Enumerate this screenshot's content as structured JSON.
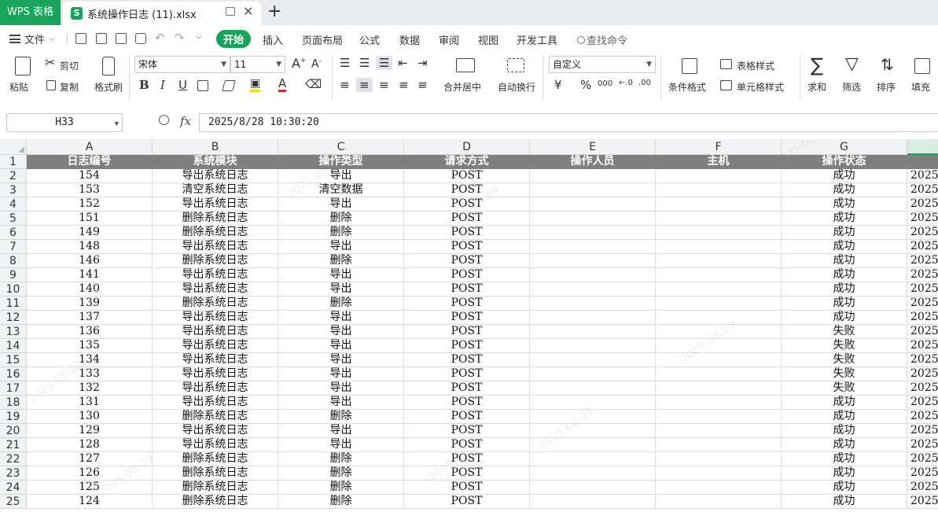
{
  "titlebar": {
    "app_name": "WPS 表格",
    "doc_icon_letter": "S",
    "doc_name": "系统操作日志 (11).xlsx",
    "close_glyph": "✕",
    "new_tab_glyph": "+"
  },
  "menubar": {
    "file_label": "文件",
    "tabs": [
      "开始",
      "插入",
      "页面布局",
      "公式",
      "数据",
      "审阅",
      "视图",
      "开发工具"
    ],
    "search_label": "查找命令"
  },
  "ribbon": {
    "paste": "粘贴",
    "cut": "剪切",
    "copy": "复制",
    "format_painter": "格式刷",
    "font_name": "宋体",
    "font_size": "11",
    "bold": "B",
    "italic": "I",
    "underline": "U",
    "font_color_glyph": "A",
    "merge_center": "合并居中",
    "wrap_text": "自动换行",
    "number_format": "自定义",
    "currency_glyph": "¥",
    "percent_glyph": "%",
    "thousands_glyph": "000",
    "conditional_format": "条件格式",
    "table_style": "表格样式",
    "cell_style": "单元格样式",
    "sum": "求和",
    "filter": "筛选",
    "sort": "排序",
    "fill": "填充"
  },
  "formula": {
    "cell_ref": "H33",
    "fx_label": "fx",
    "value": "2025/8/28 10:30:20"
  },
  "grid": {
    "columns": [
      "A",
      "B",
      "C",
      "D",
      "E",
      "F",
      "G",
      ""
    ],
    "rows": [
      {
        "n": "1",
        "cells": [
          "日志编号",
          "系统模块",
          "操作类型",
          "请求方式",
          "操作人员",
          "主机",
          "操作状态",
          ""
        ]
      },
      {
        "n": "2",
        "cells": [
          "154",
          "导出系统日志",
          "导出",
          "POST",
          "",
          "",
          "成功",
          "2025-"
        ]
      },
      {
        "n": "3",
        "cells": [
          "153",
          "清空系统日志",
          "清空数据",
          "POST",
          "",
          "",
          "成功",
          "2025-"
        ]
      },
      {
        "n": "4",
        "cells": [
          "152",
          "导出系统日志",
          "导出",
          "POST",
          "",
          "",
          "成功",
          "2025-"
        ]
      },
      {
        "n": "5",
        "cells": [
          "151",
          "删除系统日志",
          "删除",
          "POST",
          "",
          "",
          "成功",
          "2025-"
        ]
      },
      {
        "n": "6",
        "cells": [
          "149",
          "删除系统日志",
          "删除",
          "POST",
          "",
          "",
          "成功",
          "2025-"
        ]
      },
      {
        "n": "7",
        "cells": [
          "148",
          "导出系统日志",
          "导出",
          "POST",
          "",
          "",
          "成功",
          "2025-"
        ]
      },
      {
        "n": "8",
        "cells": [
          "146",
          "删除系统日志",
          "删除",
          "POST",
          "",
          "",
          "成功",
          "2025-"
        ]
      },
      {
        "n": "9",
        "cells": [
          "141",
          "导出系统日志",
          "导出",
          "POST",
          "",
          "",
          "成功",
          "2025-"
        ]
      },
      {
        "n": "10",
        "cells": [
          "140",
          "导出系统日志",
          "导出",
          "POST",
          "",
          "",
          "成功",
          "2025-"
        ]
      },
      {
        "n": "11",
        "cells": [
          "139",
          "删除系统日志",
          "删除",
          "POST",
          "",
          "",
          "成功",
          "2025-"
        ]
      },
      {
        "n": "12",
        "cells": [
          "137",
          "导出系统日志",
          "导出",
          "POST",
          "",
          "",
          "成功",
          "2025-"
        ]
      },
      {
        "n": "13",
        "cells": [
          "136",
          "导出系统日志",
          "导出",
          "POST",
          "",
          "",
          "失败",
          "2025-"
        ]
      },
      {
        "n": "14",
        "cells": [
          "135",
          "导出系统日志",
          "导出",
          "POST",
          "",
          "",
          "失败",
          "2025-"
        ]
      },
      {
        "n": "15",
        "cells": [
          "134",
          "导出系统日志",
          "导出",
          "POST",
          "",
          "",
          "失败",
          "2025-"
        ]
      },
      {
        "n": "16",
        "cells": [
          "133",
          "导出系统日志",
          "导出",
          "POST",
          "",
          "",
          "失败",
          "2025-"
        ]
      },
      {
        "n": "17",
        "cells": [
          "132",
          "导出系统日志",
          "导出",
          "POST",
          "",
          "",
          "失败",
          "2025-"
        ]
      },
      {
        "n": "18",
        "cells": [
          "131",
          "导出系统日志",
          "导出",
          "POST",
          "",
          "",
          "成功",
          "2025-"
        ]
      },
      {
        "n": "19",
        "cells": [
          "130",
          "删除系统日志",
          "删除",
          "POST",
          "",
          "",
          "成功",
          "2025-"
        ]
      },
      {
        "n": "20",
        "cells": [
          "129",
          "导出系统日志",
          "导出",
          "POST",
          "",
          "",
          "成功",
          "2025-"
        ]
      },
      {
        "n": "21",
        "cells": [
          "128",
          "导出系统日志",
          "导出",
          "POST",
          "",
          "",
          "成功",
          "2025-"
        ]
      },
      {
        "n": "22",
        "cells": [
          "127",
          "删除系统日志",
          "删除",
          "POST",
          "",
          "",
          "成功",
          "2025-"
        ]
      },
      {
        "n": "23",
        "cells": [
          "126",
          "删除系统日志",
          "删除",
          "POST",
          "",
          "",
          "成功",
          "2025-"
        ]
      },
      {
        "n": "24",
        "cells": [
          "125",
          "删除系统日志",
          "删除",
          "POST",
          "",
          "",
          "成功",
          "2025-"
        ]
      },
      {
        "n": "25",
        "cells": [
          "124",
          "删除系统日志",
          "删除",
          "POST",
          "",
          "",
          "成功",
          "2025-"
        ]
      }
    ]
  },
  "watermark": {
    "date": "2025-08-29"
  },
  "colors": {
    "brand_green": "#19a45b",
    "header_row_bg": "#7f7f7f"
  }
}
